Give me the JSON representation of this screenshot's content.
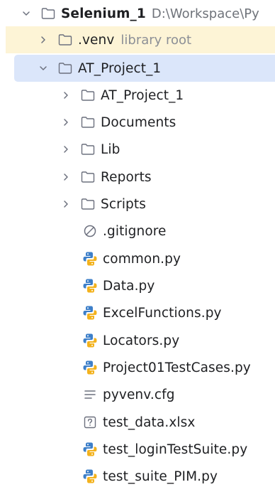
{
  "project_tree": {
    "root": {
      "name": "Selenium_1",
      "path": "D:\\Workspace\\Py"
    },
    "venv": {
      "name": ".venv",
      "hint": "library root"
    },
    "project": {
      "name": "AT_Project_1"
    },
    "children": [
      {
        "name": "AT_Project_1",
        "type": "folder",
        "icon": "folder-icon"
      },
      {
        "name": "Documents",
        "type": "folder",
        "icon": "folder-icon"
      },
      {
        "name": "Lib",
        "type": "folder",
        "icon": "folder-icon"
      },
      {
        "name": "Reports",
        "type": "folder",
        "icon": "folder-icon"
      },
      {
        "name": "Scripts",
        "type": "folder",
        "icon": "folder-icon"
      },
      {
        "name": ".gitignore",
        "type": "file",
        "icon": "ignore-file-icon"
      },
      {
        "name": "common.py",
        "type": "file",
        "icon": "python-file-icon"
      },
      {
        "name": "Data.py",
        "type": "file",
        "icon": "python-file-icon"
      },
      {
        "name": "ExcelFunctions.py",
        "type": "file",
        "icon": "python-file-icon"
      },
      {
        "name": "Locators.py",
        "type": "file",
        "icon": "python-file-icon"
      },
      {
        "name": "Project01TestCases.py",
        "type": "file",
        "icon": "python-file-icon"
      },
      {
        "name": "pyvenv.cfg",
        "type": "file",
        "icon": "text-file-icon"
      },
      {
        "name": "test_data.xlsx",
        "type": "file",
        "icon": "unknown-file-icon"
      },
      {
        "name": "test_loginTestSuite.py",
        "type": "file",
        "icon": "python-file-icon"
      },
      {
        "name": "test_suite_PIM.py",
        "type": "file",
        "icon": "python-file-icon"
      }
    ]
  },
  "colors": {
    "selected_row": "#dbe6fa",
    "excluded_row": "#fdf4d6",
    "python_blue": "#3d7fc9",
    "python_yellow": "#f3b21d",
    "hint_gray": "#8c8f96"
  }
}
